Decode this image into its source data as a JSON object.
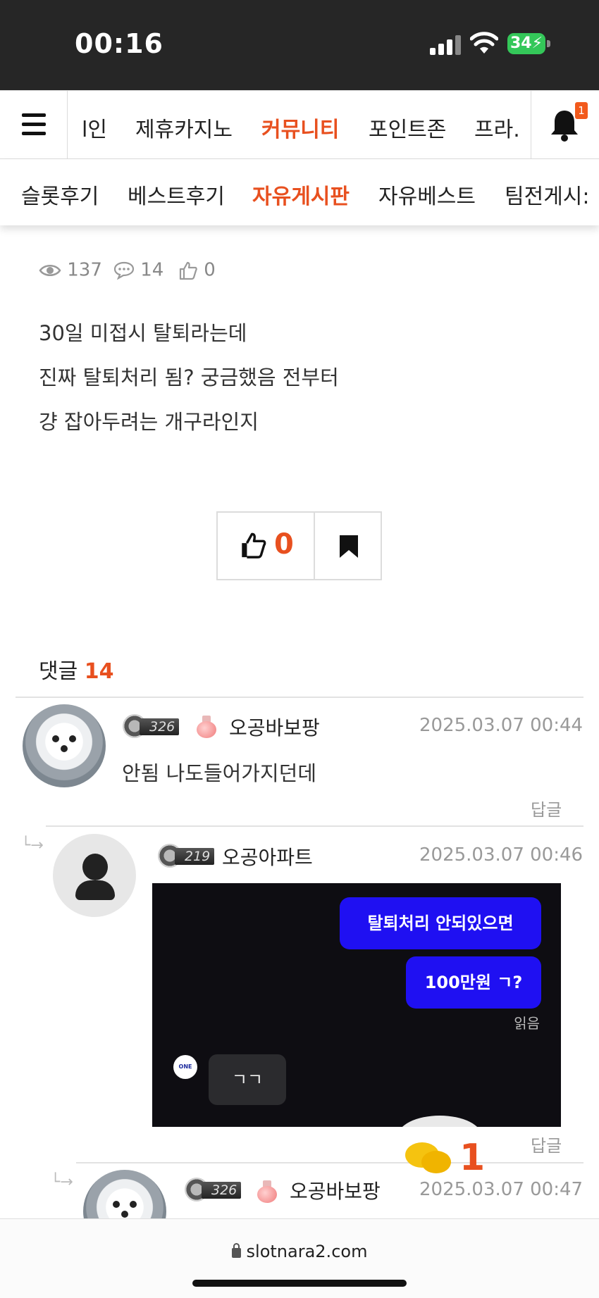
{
  "status_bar": {
    "time": "00:16",
    "battery": "34"
  },
  "main_nav": {
    "items": [
      {
        "label": "l인",
        "active": false
      },
      {
        "label": "제휴카지노",
        "active": false
      },
      {
        "label": "커뮤니티",
        "active": true
      },
      {
        "label": "포인트존",
        "active": false
      },
      {
        "label": "프라.",
        "active": false
      }
    ],
    "notification_count": "1"
  },
  "sub_nav": {
    "items": [
      {
        "label": "슬롯후기",
        "active": false
      },
      {
        "label": "베스트후기",
        "active": false
      },
      {
        "label": "자유게시판",
        "active": true
      },
      {
        "label": "자유베스트",
        "active": false
      },
      {
        "label": "팀전게시:",
        "active": false
      }
    ]
  },
  "post": {
    "views": "137",
    "comments": "14",
    "likes": "0",
    "body": [
      "30일 미접시 탈퇴라는데",
      "진짜 탈퇴처리 됨? 궁금했음 전부터",
      "걍 잡아두려는 개구라인지"
    ],
    "like_count": "0"
  },
  "comments_section": {
    "title": "댓글",
    "count": "14",
    "reply_label": "답글",
    "items": [
      {
        "level": "326",
        "author": "오공바보팡",
        "date": "2025.03.07 00:44",
        "text": "안됨 나도들어가지던데"
      },
      {
        "level": "219",
        "author": "오공아파트",
        "date": "2025.03.07 00:46",
        "image": {
          "bubble1": "탈퇴처리 안되있으면",
          "bubble2": "100만원 ㄱ?",
          "read": "읽음",
          "avatar_text": "ONE",
          "reply_bubble": "ㄱㄱ"
        }
      },
      {
        "level": "326",
        "author": "오공바보팡",
        "date": "2025.03.07 00:47"
      }
    ]
  },
  "chat_fab": {
    "count": "1"
  },
  "browser": {
    "url": "slotnara2.com"
  }
}
